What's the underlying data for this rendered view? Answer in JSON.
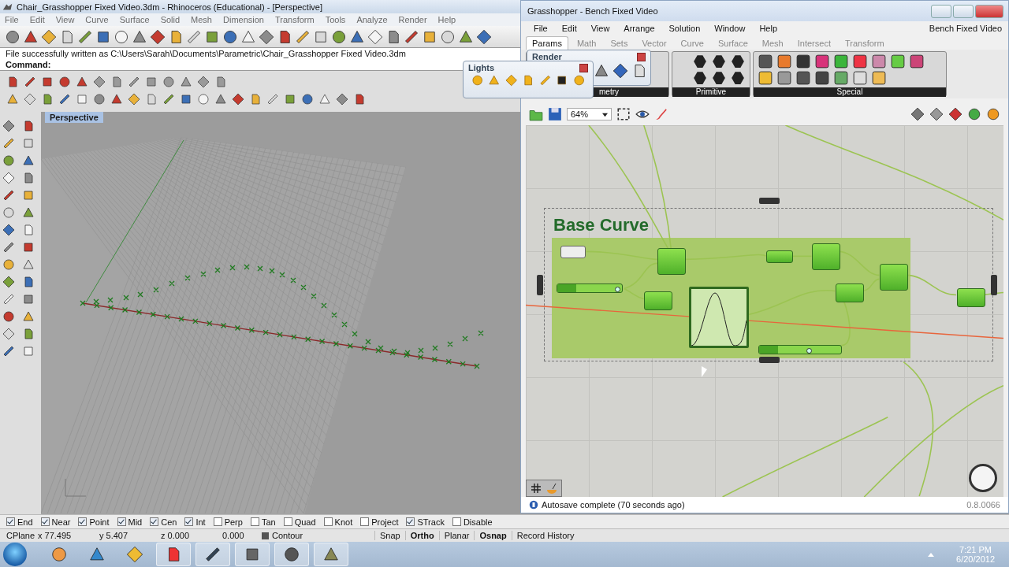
{
  "rhino": {
    "title": "Chair_Grasshopper Fixed Video.3dm - Rhinoceros (Educational) - [Perspective]",
    "menu": [
      "File",
      "Edit",
      "View",
      "Curve",
      "Surface",
      "Solid",
      "Mesh",
      "Dimension",
      "Transform",
      "Tools",
      "Analyze",
      "Render",
      "Help"
    ],
    "history": "File successfully written as C:\\Users\\Sarah\\Documents\\Parametric\\Chair_Grasshopper Fixed Video.3dm",
    "command": "Command:",
    "viewport": "Perspective",
    "osnap": [
      {
        "label": "End",
        "checked": true
      },
      {
        "label": "Near",
        "checked": true
      },
      {
        "label": "Point",
        "checked": true
      },
      {
        "label": "Mid",
        "checked": true
      },
      {
        "label": "Cen",
        "checked": true
      },
      {
        "label": "Int",
        "checked": true
      },
      {
        "label": "Perp",
        "checked": false
      },
      {
        "label": "Tan",
        "checked": false
      },
      {
        "label": "Quad",
        "checked": false
      },
      {
        "label": "Knot",
        "checked": false
      },
      {
        "label": "Project",
        "checked": false
      },
      {
        "label": "STrack",
        "checked": true
      },
      {
        "label": "Disable",
        "checked": false
      }
    ],
    "status": {
      "cplane": "CPlane",
      "x": "x 77.495",
      "y": "y 5.407",
      "z": "z 0.000",
      "d": "0.000",
      "layer": "Contour",
      "toggles": [
        {
          "label": "Snap",
          "on": false
        },
        {
          "label": "Ortho",
          "on": true
        },
        {
          "label": "Planar",
          "on": false
        },
        {
          "label": "Osnap",
          "on": true
        },
        {
          "label": "Record History",
          "on": false
        }
      ]
    }
  },
  "lights": {
    "title": "Lights"
  },
  "render": {
    "title": "Render"
  },
  "grasshopper": {
    "title": "Grasshopper - Bench Fixed Video",
    "menu": [
      "File",
      "Edit",
      "View",
      "Arrange",
      "Solution",
      "Window",
      "Help"
    ],
    "document": "Bench Fixed Video",
    "tabs": [
      {
        "label": "Params",
        "selected": true
      },
      {
        "label": "Math",
        "selected": false
      },
      {
        "label": "Sets",
        "selected": false
      },
      {
        "label": "Vector",
        "selected": false
      },
      {
        "label": "Curve",
        "selected": false
      },
      {
        "label": "Surface",
        "selected": false
      },
      {
        "label": "Mesh",
        "selected": false
      },
      {
        "label": "Intersect",
        "selected": false
      },
      {
        "label": "Transform",
        "selected": false
      }
    ],
    "panel_groups": [
      "metry",
      "Primitive",
      "Special"
    ],
    "zoom": "64%",
    "group_title": "Base Curve",
    "sliders": [
      {
        "level": 0.94
      },
      {
        "level": 0.62
      }
    ],
    "status": "Autosave complete (70 seconds ago)",
    "version": "0.8.0066"
  },
  "taskbar": {
    "time": "7:21 PM",
    "date": "6/20/2012"
  }
}
